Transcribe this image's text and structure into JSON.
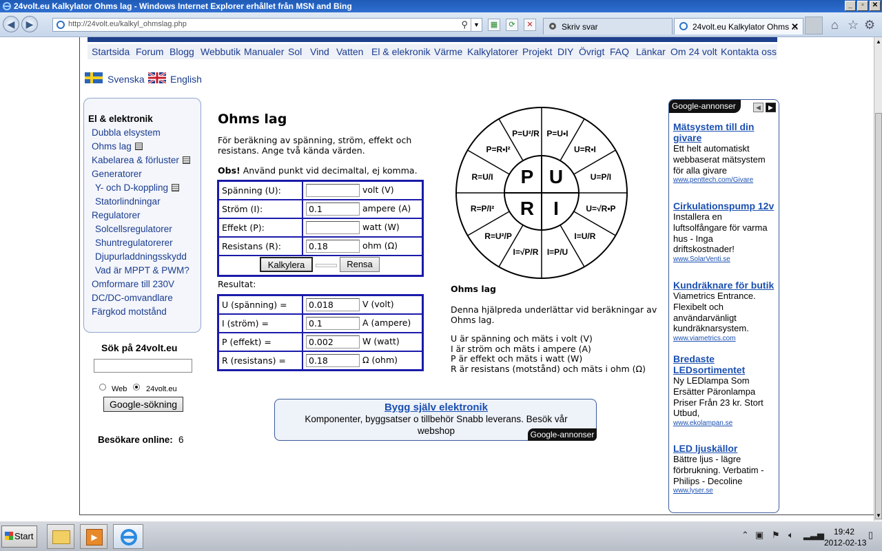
{
  "window": {
    "title": "24volt.eu Kalkylator Ohms lag - Windows Internet Explorer erhållet från MSN and Bing",
    "min": "_",
    "max": "▫",
    "close": "✕"
  },
  "browser": {
    "url": "http://24volt.eu/kalkyl_ohmslag.php",
    "tabs": [
      {
        "label": "Skriv svar"
      },
      {
        "label": "24volt.eu Kalkylator Ohms ..."
      }
    ]
  },
  "nav": {
    "items": [
      "Startsida",
      "Forum",
      "Blogg",
      "Webbutik",
      "Manualer",
      "Sol",
      "Vind",
      "Vatten",
      "El & elekronik",
      "Värme",
      "Kalkylatorer",
      "Projekt",
      "DIY",
      "Övrigt",
      "FAQ",
      "Länkar",
      "Om 24 volt",
      "Kontakta oss"
    ]
  },
  "language": {
    "swedish": "Svenska",
    "english": "English"
  },
  "sidebar": {
    "heading": "El & elektronik",
    "items": [
      "Dubbla elsystem",
      "Ohms lag",
      "Kabelarea & förluster",
      "Generatorer",
      "Y- och D-koppling",
      "Statorlindningar",
      "Regulatorer",
      "Solcellsregulatorer",
      "Shuntregulatorerer",
      "Djupurladdningsskydd",
      "Vad är MPPT & PWM?",
      "Omformare till 230V",
      "DC/DC-omvandlare",
      "Färgkod motstånd"
    ]
  },
  "search": {
    "heading": "Sök på 24volt.eu",
    "value": "",
    "radio_web": "Web",
    "radio_site": "24volt.eu",
    "button": "Google-sökning"
  },
  "visitors": {
    "label": "Besökare online:",
    "count": "6"
  },
  "calculator": {
    "title": "Ohms lag",
    "intro": "För beräkning av spänning, ström, effekt och resistans. Ange två kända värden.",
    "obs_label": "Obs!",
    "obs_text": " Använd punkt vid decimaltal, ej komma.",
    "inputs": [
      {
        "label": "Spänning (U):",
        "value": "",
        "unit": "volt (V)"
      },
      {
        "label": "Ström (I):",
        "value": "0.1",
        "unit": "ampere (A)"
      },
      {
        "label": "Effekt (P):",
        "value": "",
        "unit": "watt (W)"
      },
      {
        "label": "Resistans (R):",
        "value": "0.18",
        "unit": "ohm (Ω)"
      }
    ],
    "calc_button": "Kalkylera",
    "clear_button": "Rensa",
    "result_heading": "Resultat:",
    "results": [
      {
        "label": "U (spänning) =",
        "value": "0.018",
        "unit": "V (volt)"
      },
      {
        "label": "I (ström) =",
        "value": "0.1",
        "unit": "A (ampere)"
      },
      {
        "label": "P (effekt) =",
        "value": "0.002",
        "unit": "W (watt)"
      },
      {
        "label": "R (resistans) =",
        "value": "0.18",
        "unit": "Ω (ohm)"
      }
    ]
  },
  "wheel": {
    "center": [
      "P",
      "U",
      "R",
      "I"
    ],
    "formulas": [
      "P=U•I",
      "U=R•I",
      "U=P/I",
      "U=√R•P",
      "I=U/R",
      "I=P/U",
      "I=√P/R",
      "R=U²/P",
      "R=P/I²",
      "R=U/I",
      "P=R•I²",
      "P=U²/R"
    ]
  },
  "info": {
    "title": "Ohms lag",
    "text": "Denna hjälpreda underlättar vid beräkningar av Ohms lag.",
    "lines": [
      "U är spänning och mäts i volt (V)",
      "I är ström och mäts i ampere (A)",
      "P är effekt och mäts i watt (W)",
      "R är resistans (motstånd) och mäts i ohm (Ω)"
    ]
  },
  "banner": {
    "title": "Bygg själv elektronik",
    "text": "Komponenter, byggsatser o tillbehör Snabb leverans. Besök vår webshop",
    "badge": "Google-annonser"
  },
  "ads": {
    "header": "Google-annonser",
    "items": [
      {
        "title": "Mätsystem till din givare",
        "body": "Ett helt automatiskt webbaserat mätsystem för alla givare",
        "url": "www.penttech.com/Givare"
      },
      {
        "title": "Cirkulationspump 12v",
        "body": "Installera en luftsolfångare för varma hus - Inga driftskostnader!",
        "url": "www.SolarVenti.se"
      },
      {
        "title": "Kundräknare för butik",
        "body": "Viametrics Entrance. Flexibelt och användarvänligt kundräknarsystem.",
        "url": "www.viametrics.com"
      },
      {
        "title": "Bredaste LEDsortimentet",
        "body": "Ny LEDlampa Som Ersätter Päronlampa Priser Från 23 kr. Stort Utbud,",
        "url": "www.ekolampan.se"
      },
      {
        "title": "LED ljuskällor",
        "body": "Bättre ljus - lägre förbrukning. Verbatim - Philips - Decoline",
        "url": "www.lyser.se"
      }
    ]
  },
  "taskbar": {
    "start": "Start",
    "time": "19:42",
    "date": "2012-02-13"
  },
  "colors": {
    "navy": "#1a3c8f",
    "table_border": "#1a1aaa",
    "title_bar": "#2f6fd0"
  }
}
